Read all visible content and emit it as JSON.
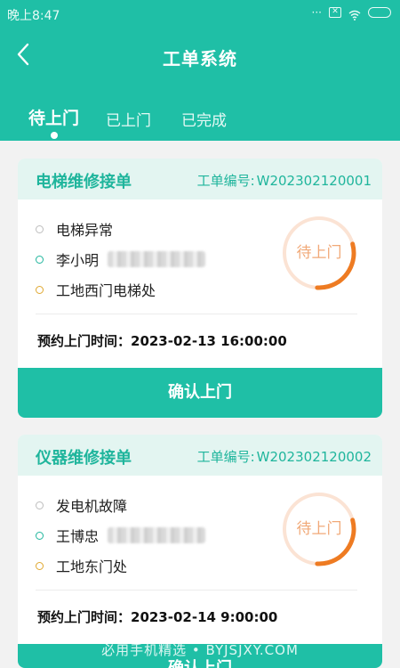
{
  "status_bar": {
    "time": "晚上8:47",
    "dots": "···",
    "x_icon": "✕"
  },
  "header": {
    "title": "工单系统"
  },
  "tabs": [
    {
      "label": "待上门",
      "active": true
    },
    {
      "label": "已上门",
      "active": false
    },
    {
      "label": "已完成",
      "active": false
    }
  ],
  "orders": [
    {
      "type_label": "电梯维修接单",
      "order_no_label": "工单编号:",
      "order_no": "W202302120001",
      "fault": "电梯异常",
      "contact_name": "李小明",
      "location": "工地西门电梯处",
      "status": "待上门",
      "status_progress": 0.3,
      "appointment": "预约上门时间：2023-02-13 16:00:00",
      "button_label": "确认上门"
    },
    {
      "type_label": "仪器维修接单",
      "order_no_label": "工单编号:",
      "order_no": "W202302120002",
      "fault": "发电机故障",
      "contact_name": "王博忠",
      "location": "工地东门处",
      "status": "待上门",
      "status_progress": 0.3,
      "appointment": "预约上门时间：2023-02-14 9:00:00",
      "button_label": "确认上门"
    }
  ],
  "watermark": "必用手机精选 • BYJSJXY.COM",
  "colors": {
    "primary": "#1fbfa6",
    "card_head": "#e3f5f1",
    "ring_track": "#fbe3d4",
    "ring_progress": "#ee7b22"
  }
}
